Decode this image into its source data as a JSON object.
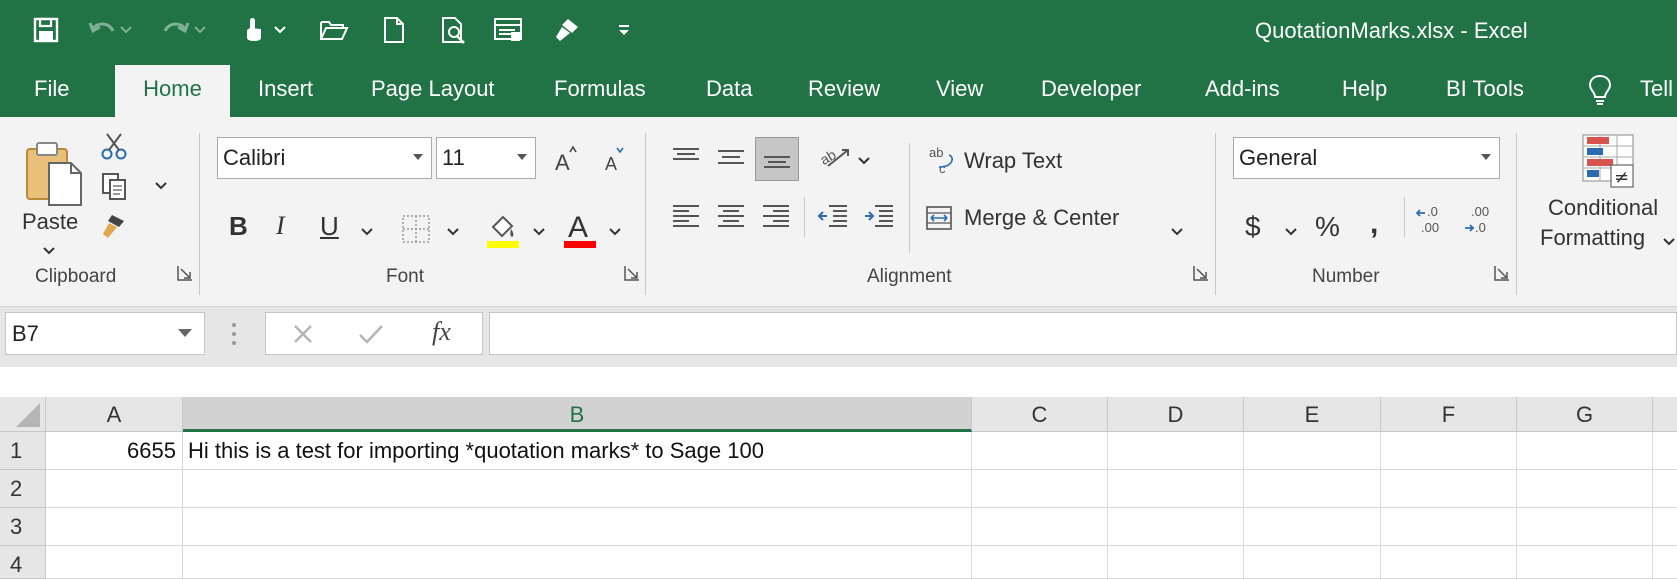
{
  "app": {
    "title": "QuotationMarks.xlsx  -  Excel",
    "accent_color": "#217346"
  },
  "quick_access": [
    "save-icon",
    "undo-icon",
    "redo-icon",
    "touch-mode-icon",
    "open-icon",
    "new-icon",
    "print-preview-icon",
    "form-icon",
    "format-painter-icon",
    "customize-qat-icon"
  ],
  "tabs": [
    {
      "label": "File"
    },
    {
      "label": "Home",
      "active": true
    },
    {
      "label": "Insert"
    },
    {
      "label": "Page Layout"
    },
    {
      "label": "Formulas"
    },
    {
      "label": "Data"
    },
    {
      "label": "Review"
    },
    {
      "label": "View"
    },
    {
      "label": "Developer"
    },
    {
      "label": "Add-ins"
    },
    {
      "label": "Help"
    },
    {
      "label": "BI Tools"
    },
    {
      "label": "Tell"
    }
  ],
  "ribbon": {
    "clipboard": {
      "label": "Clipboard",
      "paste_label": "Paste"
    },
    "font": {
      "label": "Font",
      "font_name": "Calibri",
      "font_size": "11",
      "fill_color": "#ffff00",
      "font_color": "#ff0000",
      "bold": "B",
      "italic": "I",
      "underline": "U"
    },
    "alignment": {
      "label": "Alignment",
      "wrap_text": "Wrap Text",
      "merge_center": "Merge & Center"
    },
    "number": {
      "label": "Number",
      "format": "General"
    },
    "styles": {
      "conditional_line1": "Conditional",
      "conditional_line2": "Formatting"
    }
  },
  "formula_bar": {
    "name_box": "B7",
    "formula": "",
    "fx": "fx"
  },
  "sheet": {
    "columns": [
      "A",
      "B",
      "C",
      "D",
      "E",
      "F",
      "G"
    ],
    "selected_column": "B",
    "rows": [
      "1",
      "2",
      "3",
      "4"
    ],
    "cells": {
      "A1": "6655",
      "B1": "Hi this is a test for importing *quotation marks* to Sage 100"
    }
  }
}
